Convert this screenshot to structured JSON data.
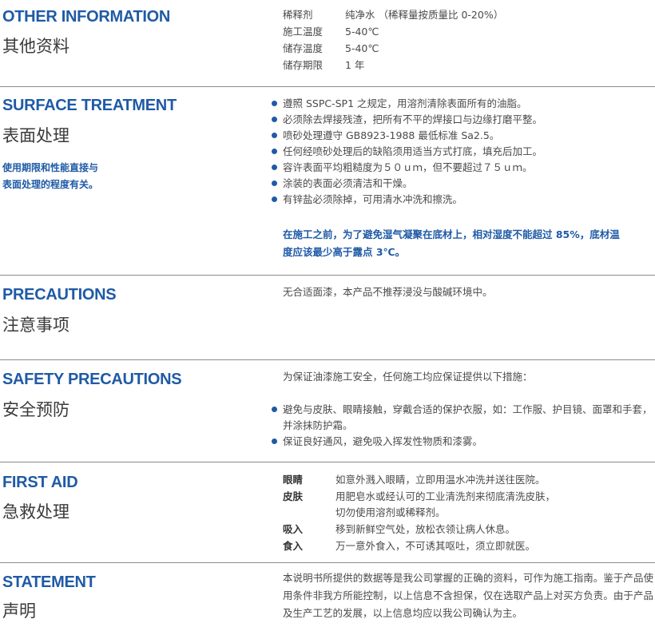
{
  "other": {
    "title_en": "OTHER INFORMATION",
    "title_cn": "其他资料",
    "rows": [
      {
        "label": "稀释剂",
        "value": "纯净水 （稀释量按质量比 0-20%）"
      },
      {
        "label": "施工温度",
        "value": "5-40℃"
      },
      {
        "label": "储存温度",
        "value": "5-40℃"
      },
      {
        "label": "储存期限",
        "value": "1 年"
      }
    ]
  },
  "surface": {
    "title_en": "SURFACE TREATMENT",
    "title_cn": "表面处理",
    "note_line1": "使用期限和性能直接与",
    "note_line2": "表面处理的程度有关。",
    "items": [
      "遵照 SSPC-SP1 之规定，用溶剂清除表面所有的油脂。",
      "必须除去焊接残渣，把所有不平的焊接口与边缘打磨平整。",
      "喷砂处理遵守 GB8923-1988 最低标准 Sa2.5。",
      "任何经喷砂处理后的缺陷须用适当方式打底，填充后加工。",
      "容许表面平均粗糙度为５０ｕｍ，但不要超过７５ｕｍ。",
      "涂装的表面必须清洁和干燥。",
      "有锌盐必须除掉，可用清水冲洗和擦洗。"
    ],
    "warning_line1": "在施工之前，为了避免湿气凝聚在底材上，相对湿度不能超过 85%，底材温",
    "warning_line2": "度应该最少高于露点 3℃。"
  },
  "precautions": {
    "title_en": "PRECAUTIONS",
    "title_cn": "注意事项",
    "text": "无合适面漆，本产品不推荐浸没与酸碱环境中。"
  },
  "safety": {
    "title_en": "SAFETY PRECAUTIONS",
    "title_cn": "安全预防",
    "intro": "为保证油漆施工安全，任何施工均应保证提供以下措施：",
    "item1_line1": "避免与皮肤、眼睛接触，穿戴合适的保护衣服，如：工作服、护目镜、面罩和手套，",
    "item1_line2": "并涂抹防护霜。",
    "item2": "保证良好通风，避免吸入挥发性物质和漆雾。"
  },
  "firstaid": {
    "title_en": "FIRST AID",
    "title_cn": "急救处理",
    "rows": [
      {
        "label": "眼睛",
        "line1": "如意外溅入眼睛，立即用温水冲洗并送往医院。",
        "line2": ""
      },
      {
        "label": "皮肤",
        "line1": "用肥皂水或经认可的工业清洗剂来彻底清洗皮肤，",
        "line2": "切勿使用溶剂或稀释剂。"
      },
      {
        "label": "吸入",
        "line1": "移到新鲜空气处，放松衣领让病人休息。",
        "line2": ""
      },
      {
        "label": "食入",
        "line1": "万一意外食入，不可诱其呕吐，须立即就医。",
        "line2": ""
      }
    ]
  },
  "statement": {
    "title_en": "STATEMENT",
    "title_cn": "声明",
    "text": "本说明书所提供的数据等是我公司掌握的正确的资料，可作为施工指南。鉴于产品使用条件非我方所能控制，以上信息不含担保，仅在选取产品上对买方负责。由于产品及生产工艺的发展，以上信息均应以我公司确认为主。"
  }
}
